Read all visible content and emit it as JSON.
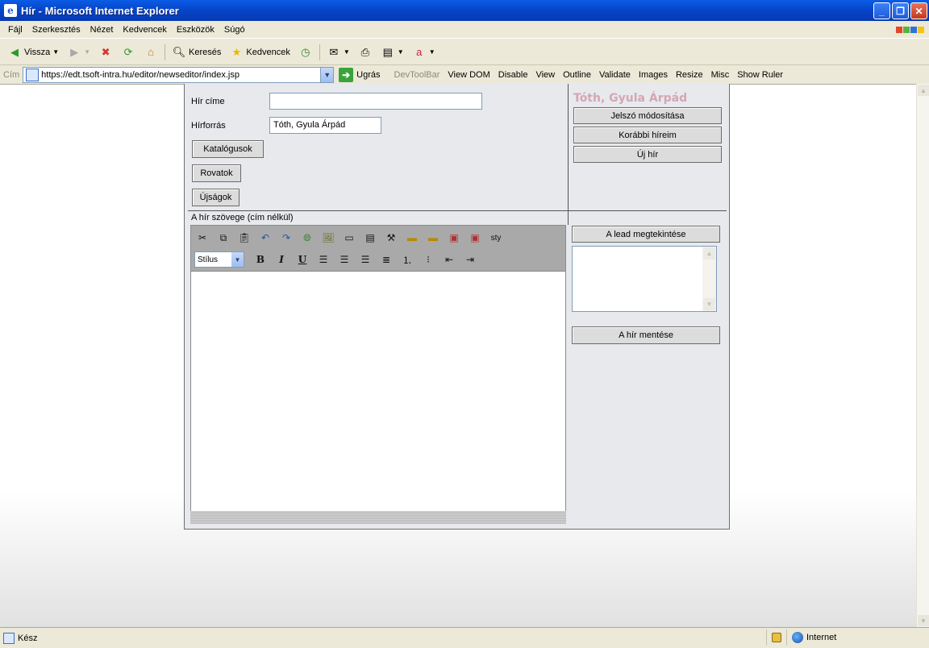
{
  "window": {
    "title": "Hír - Microsoft Internet Explorer"
  },
  "menu": [
    "Fájl",
    "Szerkesztés",
    "Nézet",
    "Kedvencek",
    "Eszközök",
    "Súgó"
  ],
  "toolbar": {
    "back_label": "Vissza",
    "search_label": "Keresés",
    "favorites_label": "Kedvencek"
  },
  "address": {
    "label": "Cím",
    "url": "https://edt.tsoft-intra.hu/editor/newseditor/index.jsp",
    "go_label": "Ugrás"
  },
  "devtools": [
    "DevToolBar",
    "View DOM",
    "Disable",
    "View",
    "Outline",
    "Validate",
    "Images",
    "Resize",
    "Misc",
    "Show Ruler"
  ],
  "form": {
    "title_label": "Hír címe",
    "title_value": "",
    "source_label": "Hírforrás",
    "source_value": "Tóth, Gyula Árpád",
    "catalogs_button": "Katalógusok",
    "columns_button": "Rovatok",
    "papers_button": "Újságok",
    "text_label": "A hír szövege (cím nélkül)"
  },
  "sidebar": {
    "author": "Tóth, Gyula Árpád",
    "change_password": "Jelszó módosítása",
    "previous_news": "Korábbi híreim",
    "new_news": "Új hír",
    "preview_lead": "A lead megtekintése",
    "save_news": "A hír mentése"
  },
  "editor": {
    "style_select": "Stílus",
    "sty_label": "sty"
  },
  "status": {
    "text": "Kész",
    "zone": "Internet"
  }
}
